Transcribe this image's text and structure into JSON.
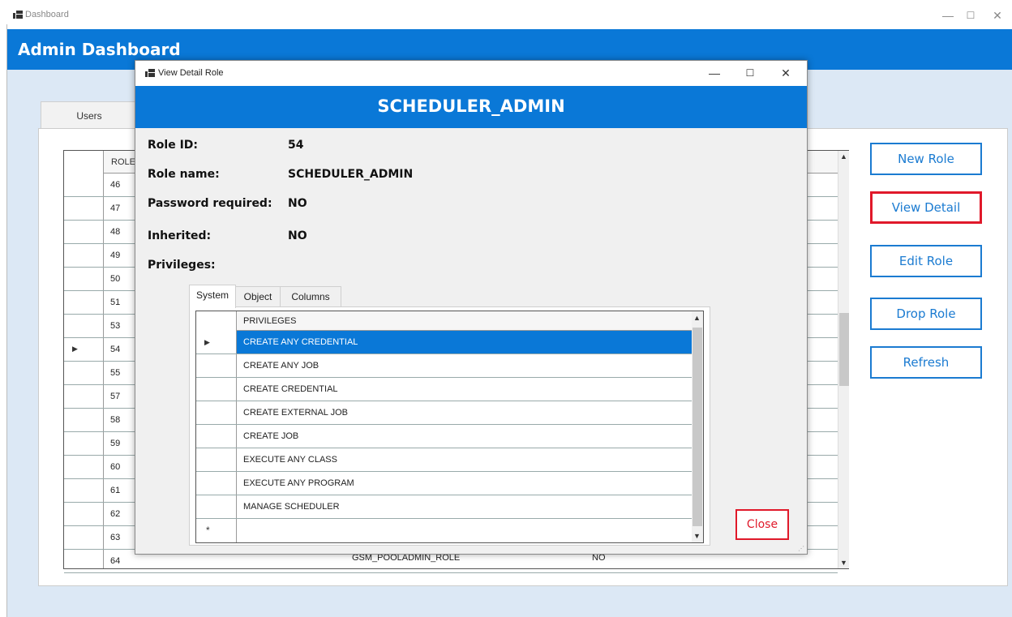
{
  "main_window": {
    "title": "Dashboard",
    "controls": {
      "minimize": "—",
      "maximize": "☐",
      "close": "✕"
    }
  },
  "header": {
    "title": "Admin Dashboard"
  },
  "tabs": [
    {
      "label": "Users"
    }
  ],
  "role_table": {
    "columns": [
      "ROLE"
    ],
    "rows": [
      {
        "id": "46",
        "name": "",
        "pw": ""
      },
      {
        "id": "47",
        "name": "",
        "pw": ""
      },
      {
        "id": "48",
        "name": "",
        "pw": ""
      },
      {
        "id": "49",
        "name": "",
        "pw": ""
      },
      {
        "id": "50",
        "name": "",
        "pw": ""
      },
      {
        "id": "51",
        "name": "",
        "pw": ""
      },
      {
        "id": "53",
        "name": "",
        "pw": ""
      },
      {
        "id": "54",
        "name": "",
        "pw": "",
        "current": true
      },
      {
        "id": "55",
        "name": "",
        "pw": ""
      },
      {
        "id": "57",
        "name": "",
        "pw": ""
      },
      {
        "id": "58",
        "name": "",
        "pw": ""
      },
      {
        "id": "59",
        "name": "",
        "pw": ""
      },
      {
        "id": "60",
        "name": "",
        "pw": ""
      },
      {
        "id": "61",
        "name": "",
        "pw": ""
      },
      {
        "id": "62",
        "name": "",
        "pw": ""
      },
      {
        "id": "63",
        "name": "",
        "pw": ""
      },
      {
        "id": "64",
        "name": "GSM_POOLADMIN_ROLE",
        "pw": "NO"
      }
    ]
  },
  "side_buttons": {
    "new_role": "New Role",
    "view_detail": "View Detail",
    "edit_role": "Edit Role",
    "drop_role": "Drop Role",
    "refresh": "Refresh"
  },
  "colors": {
    "accent": "#0a78d7",
    "highlight": "#e0192a"
  },
  "modal": {
    "title": "View Detail Role",
    "banner": "SCHEDULER_ADMIN",
    "fields": {
      "role_id_label": "Role ID:",
      "role_id_value": "54",
      "role_name_label": "Role name:",
      "role_name_value": "SCHEDULER_ADMIN",
      "password_label": "Password required:",
      "password_value": "NO",
      "inherited_label": "Inherited:",
      "inherited_value": "NO",
      "privileges_label": "Privileges:"
    },
    "priv_tabs": [
      "System",
      "Object",
      "Columns"
    ],
    "priv_grid": {
      "header": "PRIVILEGES",
      "rows": [
        "CREATE ANY CREDENTIAL",
        "CREATE ANY JOB",
        "CREATE CREDENTIAL",
        "CREATE EXTERNAL JOB",
        "CREATE JOB",
        "EXECUTE ANY CLASS",
        "EXECUTE ANY PROGRAM",
        "MANAGE SCHEDULER"
      ],
      "selected_index": 0,
      "new_row_marker": "*"
    },
    "close_label": "Close"
  }
}
